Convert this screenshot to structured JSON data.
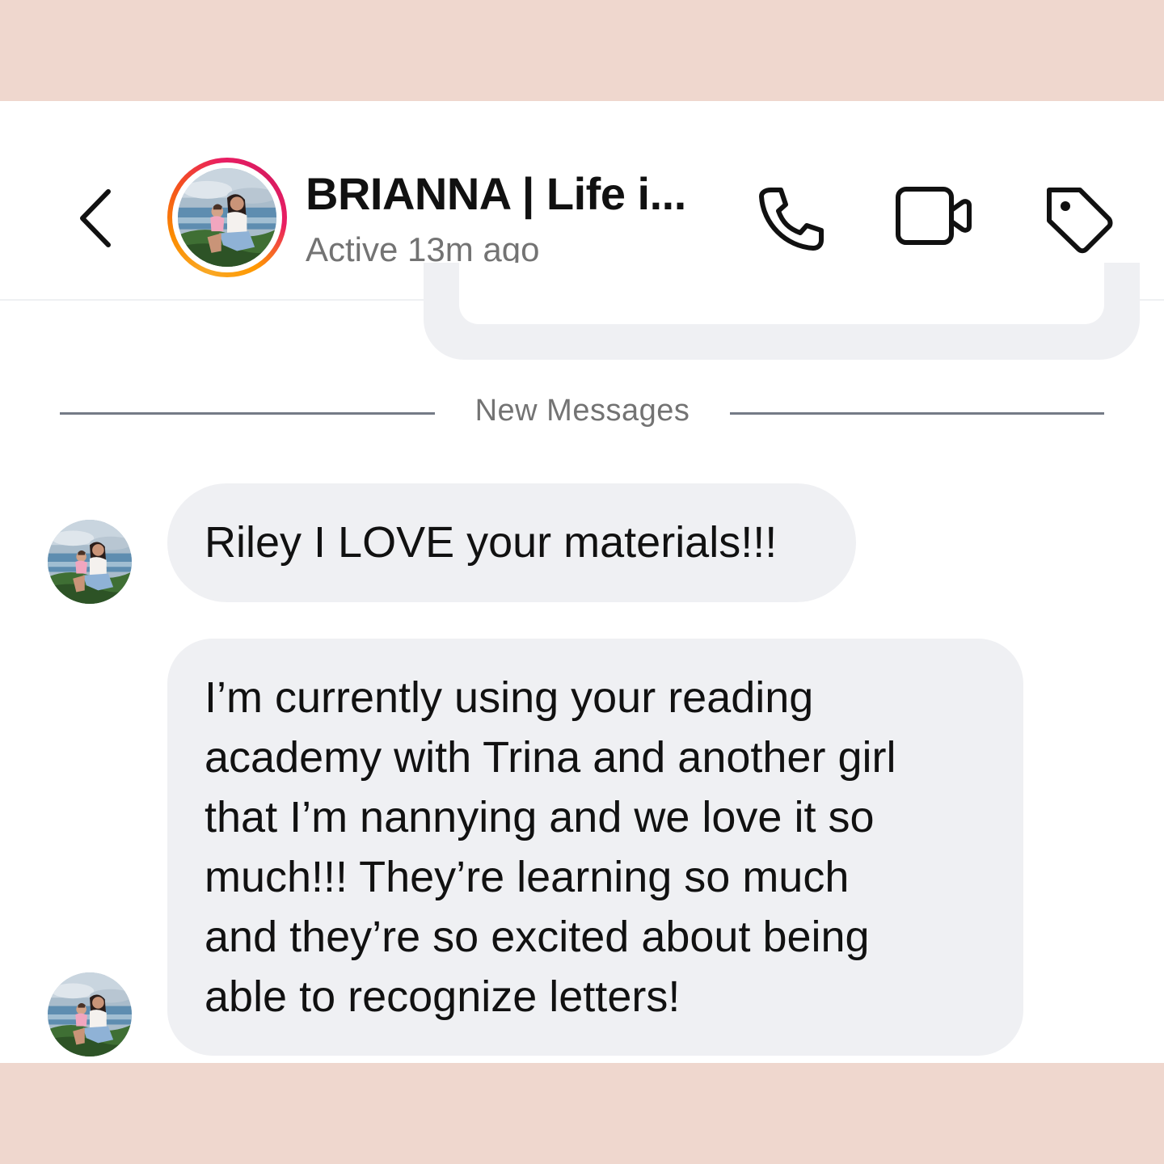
{
  "header": {
    "title": "BRIANNA | Life i...",
    "status": "Active 13m ago",
    "icons": [
      "chevron-left-icon",
      "phone-icon",
      "video-camera-icon",
      "tag-icon"
    ],
    "story_ring": true
  },
  "divider": {
    "label": "New Messages"
  },
  "messages": [
    {
      "sender": "BRIANNA",
      "text": "Riley I LOVE your materials!!!"
    },
    {
      "sender": "BRIANNA",
      "lines": [
        "I’m currently using your reading",
        "academy with Trina and another girl",
        "that I’m nannying and we love it so",
        "much!!! They’re learning so much",
        "and they’re so excited about being",
        "able to recognize letters!"
      ]
    }
  ],
  "colors": {
    "frame_background": "#efd7ce",
    "bubble_background": "#eff0f3",
    "secondary_text": "#737373",
    "primary_text": "#111111"
  }
}
